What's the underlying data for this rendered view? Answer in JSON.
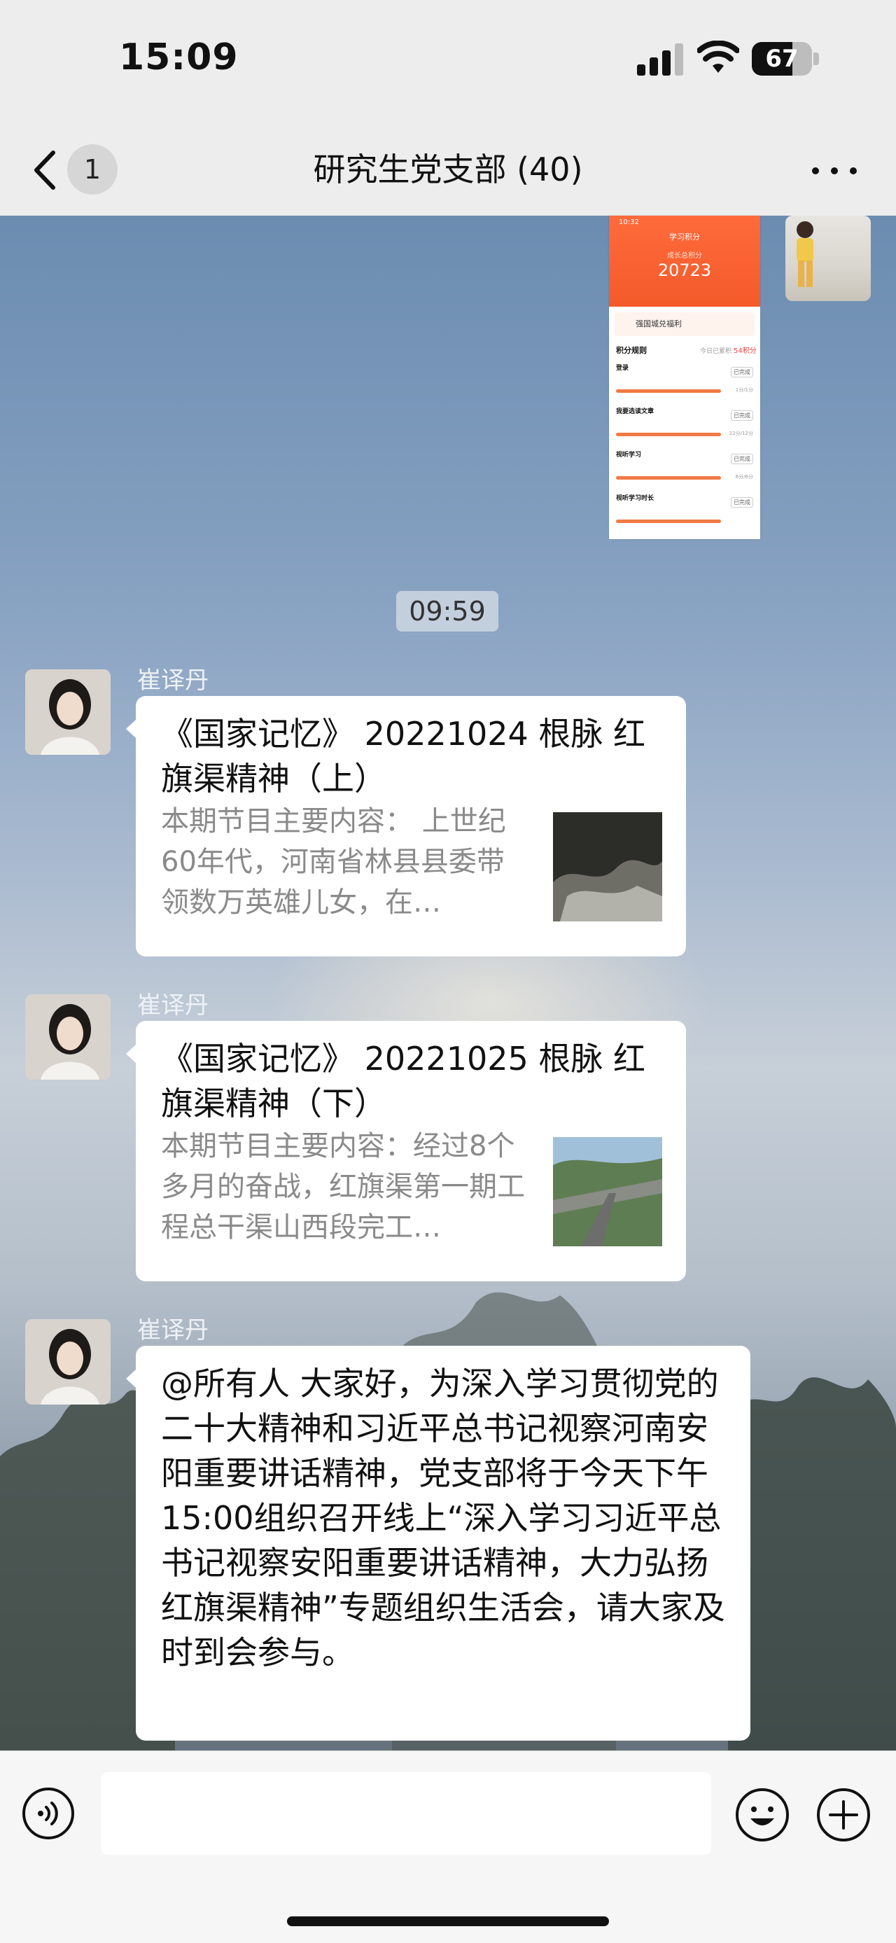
{
  "status_bar": {
    "time": "15:09",
    "battery": "67",
    "battery_level": 0.67,
    "icons": [
      "cellular-signal-icon",
      "wifi-icon",
      "battery-icon"
    ]
  },
  "header": {
    "unread_count": "1",
    "title": "研究生党支部 (40)",
    "icons": [
      "back-chevron-icon",
      "more-dots-icon"
    ]
  },
  "image_message": {
    "screenshot": {
      "time": "10:32",
      "heading": "学习积分",
      "score_caption": "成长总积分",
      "score": "20723",
      "banner": "强国城兑福利",
      "rules_title": "积分规则",
      "today_label": "今日已累积",
      "today_score": "54",
      "today_unit": "积分",
      "items": [
        {
          "name": "登录",
          "status": "已完成",
          "score": "1分/1分"
        },
        {
          "name": "我要选读文章",
          "status": "已完成",
          "score": "12分/12分"
        },
        {
          "name": "视听学习",
          "status": "已完成",
          "score": "6分/6分"
        },
        {
          "name": "视听学习时长",
          "status": "已完成",
          "score": ""
        }
      ]
    }
  },
  "timestamp": "09:59",
  "messages": [
    {
      "sender": "崔译丹",
      "type": "link",
      "title": "《国家记忆》 20221024 根脉 红旗渠精神（上）",
      "description": "本期节目主要内容：    上世纪60年代，河南省林县县委带领数万英雄儿女，在…"
    },
    {
      "sender": "崔译丹",
      "type": "link",
      "title": "《国家记忆》 20221025 根脉 红旗渠精神（下）",
      "description": "本期节目主要内容：经过8个多月的奋战，红旗渠第一期工程总干渠山西段完工…"
    },
    {
      "sender": "崔译丹",
      "type": "text",
      "text": "@所有人 大家好，为深入学习贯彻党的二十大精神和习近平总书记视察河南安阳重要讲话精神，党支部将于今天下午15:00组织召开线上“深入学习习近平总书记视察安阳重要讲话精神，大力弘扬红旗渠精神”专题组织生活会，请大家及时到会参与。"
    }
  ],
  "input_bar": {
    "placeholder": "",
    "icons": [
      "voice-icon",
      "emoji-icon",
      "plus-icon"
    ]
  }
}
